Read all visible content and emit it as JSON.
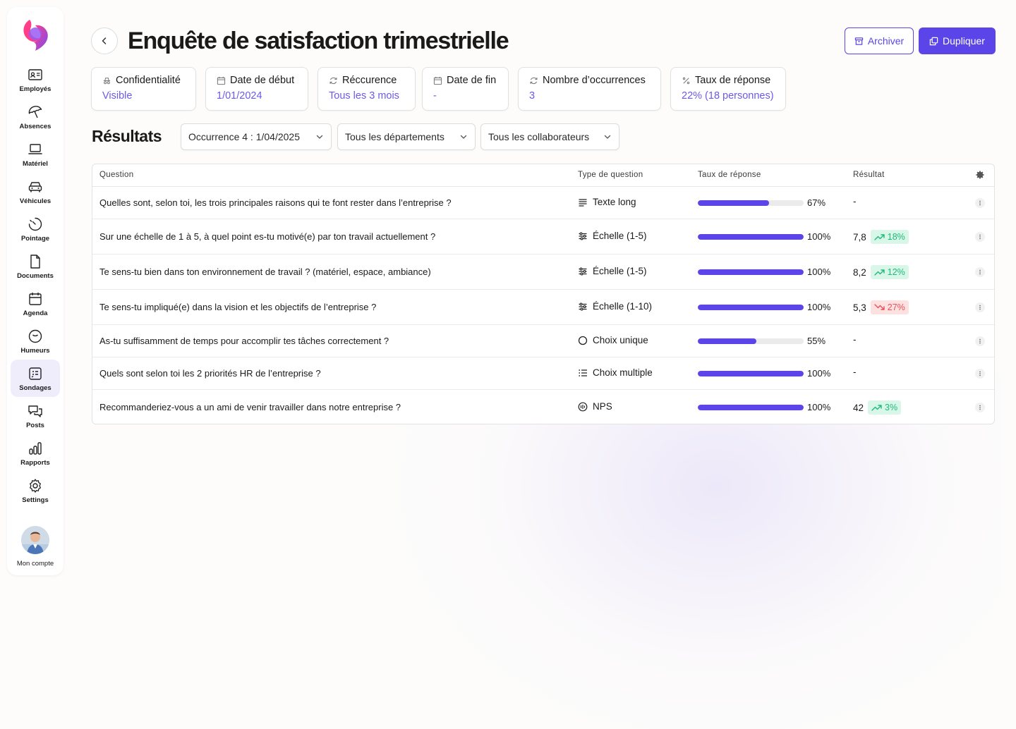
{
  "sidebar": {
    "items": [
      {
        "label": "Employés",
        "icon": "id-card-icon"
      },
      {
        "label": "Absences",
        "icon": "umbrella-icon"
      },
      {
        "label": "Matériel",
        "icon": "laptop-icon"
      },
      {
        "label": "Véhicules",
        "icon": "car-icon"
      },
      {
        "label": "Pointage",
        "icon": "clock-icon"
      },
      {
        "label": "Documents",
        "icon": "document-icon"
      },
      {
        "label": "Agenda",
        "icon": "calendar-icon"
      },
      {
        "label": "Humeurs",
        "icon": "smiley-icon"
      },
      {
        "label": "Sondages",
        "icon": "survey-icon",
        "active": true
      },
      {
        "label": "Posts",
        "icon": "chat-icon"
      },
      {
        "label": "Rapports",
        "icon": "bar-chart-icon"
      },
      {
        "label": "Settings",
        "icon": "gear-icon"
      }
    ],
    "account_label": "Mon compte"
  },
  "header": {
    "title": "Enquête de satisfaction trimestrielle",
    "archive_label": "Archiver",
    "duplicate_label": "Dupliquer"
  },
  "cards": [
    {
      "title": "Confidentialité",
      "value": "Visible",
      "icon": "incognito-icon"
    },
    {
      "title": "Date de début",
      "value": "1/01/2024",
      "icon": "calendar-icon"
    },
    {
      "title": "Réccurence",
      "value": "Tous les 3 mois",
      "icon": "refresh-icon"
    },
    {
      "title": "Date de fin",
      "value": "-",
      "icon": "calendar-icon"
    },
    {
      "title": "Nombre d’occurrences",
      "value": "3",
      "icon": "refresh-icon"
    },
    {
      "title": "Taux de réponse",
      "value": "22% (18 personnes)",
      "icon": "percent-icon"
    }
  ],
  "results": {
    "title": "Résultats",
    "filters": {
      "occurrence": "Occurrence 4 : 1/04/2025",
      "department": "Tous les départements",
      "collaborator": "Tous les collaborateurs"
    }
  },
  "table": {
    "headers": {
      "question": "Question",
      "type": "Type de question",
      "rate": "Taux de réponse",
      "result": "Résultat"
    },
    "rows": [
      {
        "question": "Quelles sont, selon toi, les trois principales raisons qui te font rester dans l’entreprise ?",
        "type": "Texte long",
        "type_icon": "text-lines-icon",
        "rate": 0.67,
        "rate_label": "67%",
        "result": "-",
        "trend": null,
        "trend_label": ""
      },
      {
        "question": "Sur une échelle de 1 à 5, à quel point es-tu motivé(e) par ton travail actuellement ?",
        "type": "Échelle (1-5)",
        "type_icon": "sliders-icon",
        "rate": 1.0,
        "rate_label": "100%",
        "result": "7,8",
        "trend": "up",
        "trend_label": "18%"
      },
      {
        "question": "Te sens-tu bien dans ton environnement de travail ? (matériel, espace, ambiance)",
        "type": "Échelle (1-5)",
        "type_icon": "sliders-icon",
        "rate": 1.0,
        "rate_label": "100%",
        "result": "8,2",
        "trend": "up",
        "trend_label": "12%"
      },
      {
        "question": "Te sens-tu impliqué(e) dans la vision et les objectifs de l’entreprise ?",
        "type": "Échelle (1-10)",
        "type_icon": "sliders-icon",
        "rate": 1.0,
        "rate_label": "100%",
        "result": "5,3",
        "trend": "down",
        "trend_label": "27%"
      },
      {
        "question": "As-tu suffisamment de temps pour accomplir tes tâches correctement ?",
        "type": "Choix unique",
        "type_icon": "radio-icon",
        "rate": 0.55,
        "rate_label": "55%",
        "result": "-",
        "trend": null,
        "trend_label": ""
      },
      {
        "question": "Quels sont selon toi les 2 priorités HR de l’entreprise ?",
        "type": "Choix multiple",
        "type_icon": "list-icon",
        "rate": 1.0,
        "rate_label": "100%",
        "result": "-",
        "trend": null,
        "trend_label": ""
      },
      {
        "question": "Recommanderiez-vous a un ami de venir travailler dans notre entreprise ?",
        "type": "NPS",
        "type_icon": "nps-icon",
        "rate": 1.0,
        "rate_label": "100%",
        "result": "42",
        "trend": "up",
        "trend_label": "3%"
      }
    ]
  },
  "colors": {
    "accent": "#5b45e8",
    "up": "#1fb97a",
    "down": "#e8505b"
  }
}
